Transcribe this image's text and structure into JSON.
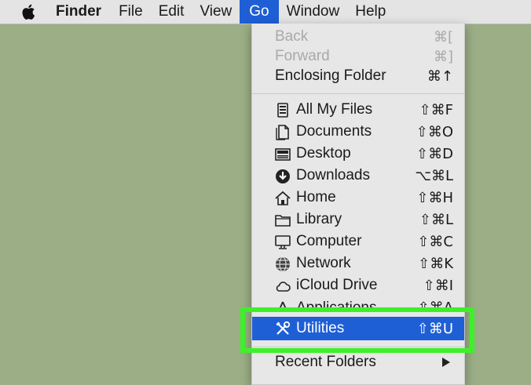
{
  "menubar": {
    "apple_icon": "apple-icon",
    "items": [
      "Finder",
      "File",
      "Edit",
      "View",
      "Go",
      "Window",
      "Help"
    ]
  },
  "go_menu": {
    "nav": [
      {
        "label": "Back",
        "shortcut": "⌘[",
        "disabled": true
      },
      {
        "label": "Forward",
        "shortcut": "⌘]",
        "disabled": true
      },
      {
        "label": "Enclosing Folder",
        "shortcut": "⌘↑",
        "disabled": false
      }
    ],
    "places": [
      {
        "label": "All My Files",
        "shortcut": "⇧⌘F",
        "icon": "all-my-files-icon"
      },
      {
        "label": "Documents",
        "shortcut": "⇧⌘O",
        "icon": "documents-icon"
      },
      {
        "label": "Desktop",
        "shortcut": "⇧⌘D",
        "icon": "desktop-icon"
      },
      {
        "label": "Downloads",
        "shortcut": "⌥⌘L",
        "icon": "downloads-icon"
      },
      {
        "label": "Home",
        "shortcut": "⇧⌘H",
        "icon": "home-icon"
      },
      {
        "label": "Library",
        "shortcut": "⇧⌘L",
        "icon": "library-folder-icon"
      },
      {
        "label": "Computer",
        "shortcut": "⇧⌘C",
        "icon": "computer-icon"
      },
      {
        "label": "Network",
        "shortcut": "⇧⌘K",
        "icon": "network-icon"
      },
      {
        "label": "iCloud Drive",
        "shortcut": "⇧⌘I",
        "icon": "icloud-icon"
      },
      {
        "label": "Applications",
        "shortcut": "⇧⌘A",
        "icon": "applications-icon"
      },
      {
        "label": "Utilities",
        "shortcut": "⇧⌘U",
        "icon": "utilities-icon",
        "highlighted": true
      }
    ],
    "recent": {
      "label": "Recent Folders"
    }
  },
  "colors": {
    "highlight": "#1f5fd6",
    "callout": "#3ef02a",
    "desktop": "#9bae86"
  }
}
